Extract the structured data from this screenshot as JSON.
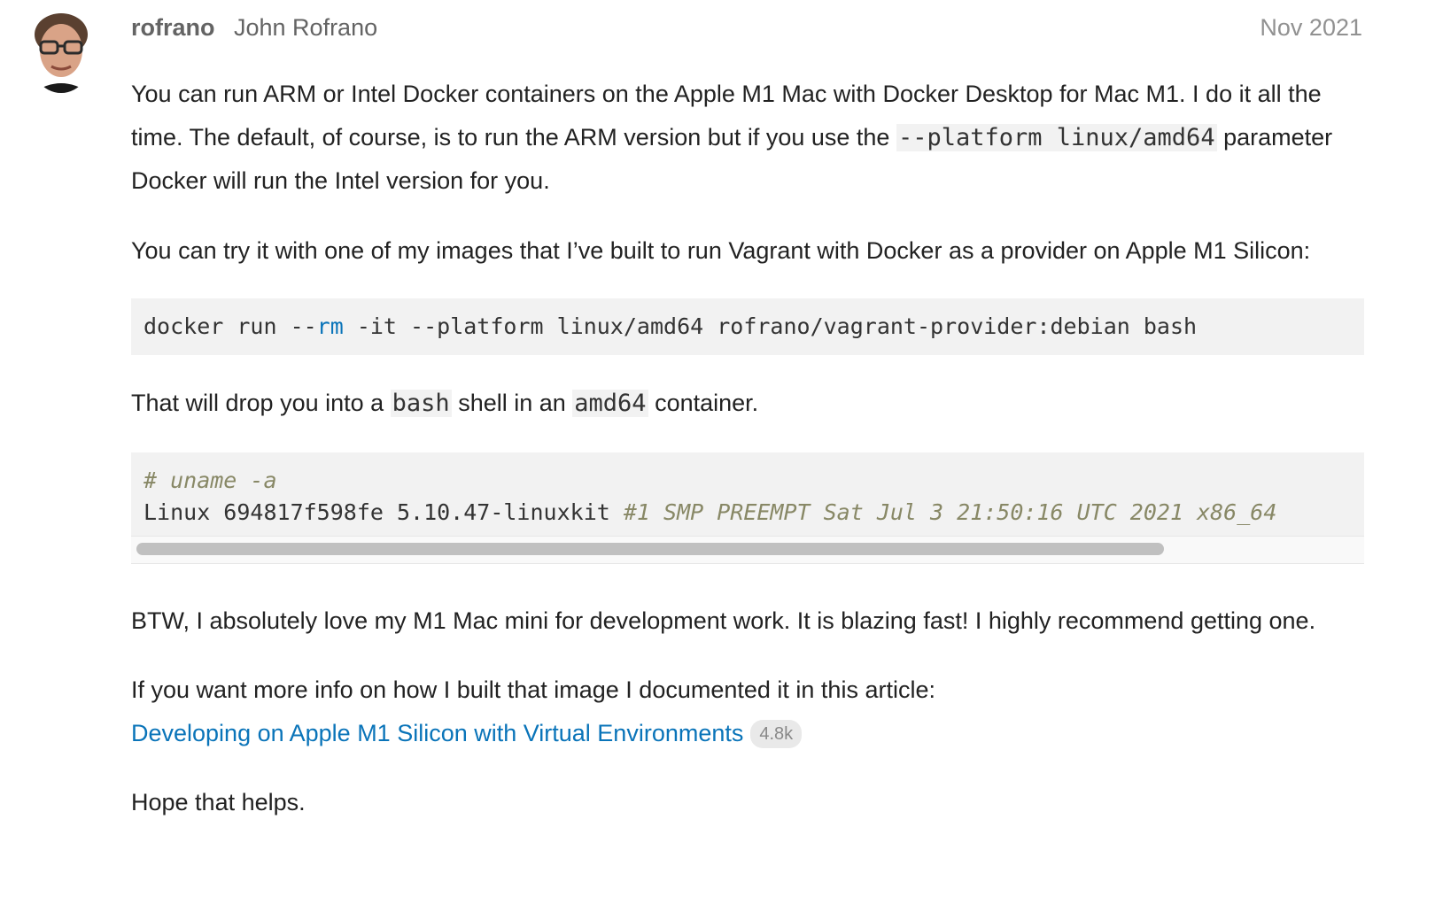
{
  "post": {
    "username": "rofrano",
    "full_name": "John Rofrano",
    "date": "Nov 2021",
    "p1": {
      "text_a": "You can run ARM or Intel Docker containers on the Apple M1 Mac with Docker Desktop for Mac M1. I do it all the time. The default, of course, is to run the ARM version but if you use the ",
      "code": "--platform linux/amd64",
      "text_b": " parameter Docker will run the Intel version for you."
    },
    "p2": "You can try it with one of my images that I’ve built to run Vagrant with Docker as a provider on Apple M1 Silicon:",
    "code_block_1": {
      "pre": "docker run --",
      "kw": "rm",
      "post": " -it --platform linux/amd64 rofrano/vagrant-provider:debian bash"
    },
    "p3": {
      "text_a": "That will drop you into a ",
      "code_a": "bash",
      "text_b": " shell in an ",
      "code_b": "amd64",
      "text_c": " container."
    },
    "code_block_2": {
      "line1_comment": "# uname -a",
      "line2_plain": "Linux 694817f598fe 5.10.47-linuxkit ",
      "line2_comment": "#1 SMP PREEMPT Sat Jul 3 21:50:16 UTC 2021 x86_64"
    },
    "p4": "BTW, I absolutely love my M1 Mac mini for development work. It is blazing fast! I highly recommend getting one.",
    "p5": {
      "text": "If you want more info on how I built that image I documented it in this article:",
      "link_text": "Developing on Apple M1 Silicon with Virtual Environments",
      "click_count": "4.8k"
    },
    "p6": "Hope that helps."
  },
  "colors": {
    "link": "#0a74b9",
    "text": "#222222",
    "muted": "#919191",
    "code_bg": "#f2f2f2"
  },
  "icons": {
    "avatar": "user-photo"
  }
}
